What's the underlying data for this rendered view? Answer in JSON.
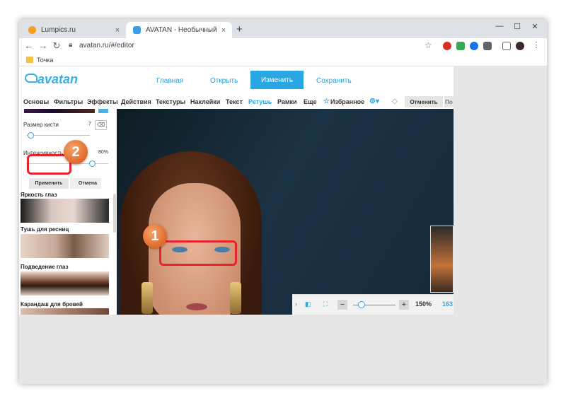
{
  "browser": {
    "tabs": [
      {
        "title": "Lumpics.ru",
        "active": false
      },
      {
        "title": "AVATAN - Необычный Фоторед",
        "active": true
      }
    ],
    "new_tab": "+",
    "close": "×",
    "url": "avatan.ru/#/editor",
    "bookmark": "Точка",
    "window_controls": {
      "minimize": "—",
      "maximize": "☐",
      "close": "✕"
    }
  },
  "site": {
    "logo": "avatan",
    "nav": [
      "Главная",
      "Открыть",
      "Изменить",
      "Сохранить"
    ],
    "nav_active": "Изменить",
    "menu": [
      "Основы",
      "Фильтры",
      "Эффекты",
      "Действия",
      "Текстуры",
      "Наклейки",
      "Текст",
      "Ретушь",
      "Рамки",
      "Еще",
      "Избранное"
    ],
    "menu_active": "Ретушь",
    "cancel": "Отменить",
    "apply_cut": "По"
  },
  "panel": {
    "brush_size_label": "Размер кисти",
    "brush_size_value": "7",
    "intensity_label": "Интенсивность",
    "intensity_value": "80%",
    "brush_size_fraction": 0.07,
    "intensity_fraction": 0.8,
    "apply": "Применить",
    "cancel": "Отмена",
    "sections": [
      "Яркость глаз",
      "Тушь для ресниц",
      "Подведение глаз",
      "Карандаш для бровей"
    ]
  },
  "zoom": {
    "level": "150%",
    "extra": "163"
  },
  "annotations": [
    "1",
    "2"
  ],
  "colors": {
    "accent": "#2aa6e2",
    "highlight": "#e8232b",
    "badge": "#e0692a"
  }
}
